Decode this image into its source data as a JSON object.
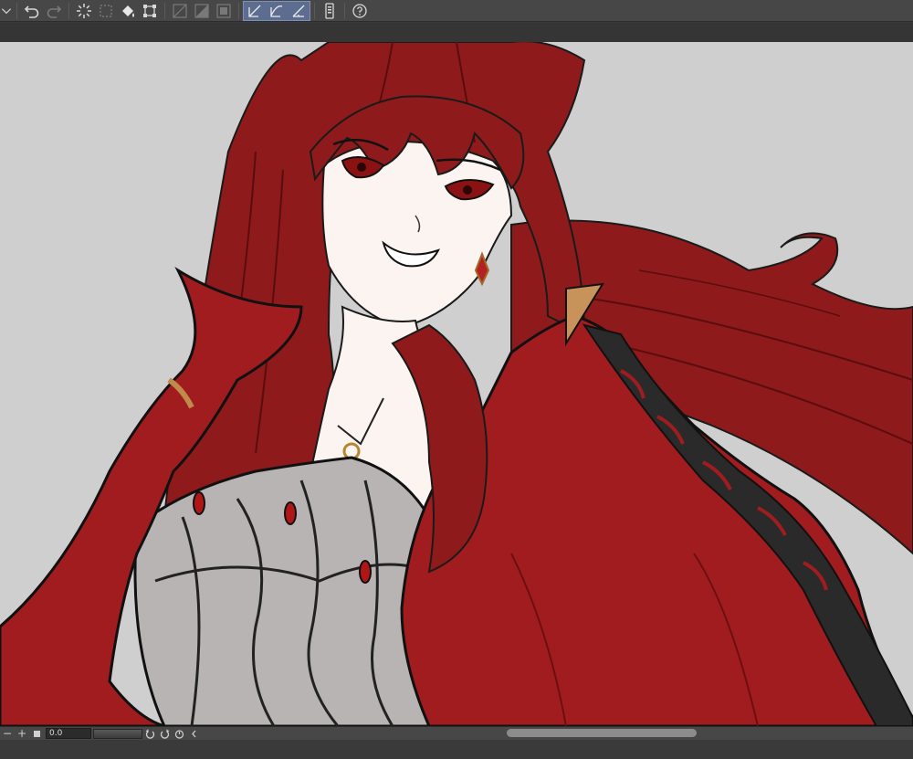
{
  "toolbar": {
    "tools": [
      {
        "name": "menu-chevron-icon"
      },
      {
        "name": "undo-icon"
      },
      {
        "name": "redo-icon"
      },
      {
        "name": "loading-spinner-icon"
      },
      {
        "name": "selection-icon"
      },
      {
        "name": "fill-icon"
      },
      {
        "name": "transform-icon"
      },
      {
        "name": "clear-outside-icon"
      },
      {
        "name": "clear-inside-icon"
      },
      {
        "name": "fill-selection-icon"
      },
      {
        "name": "snap-ruler-icon"
      },
      {
        "name": "snap-special-ruler-icon"
      },
      {
        "name": "snap-grid-icon"
      },
      {
        "name": "device-icon"
      },
      {
        "name": "help-icon"
      }
    ],
    "active_color": "#5d6d8f"
  },
  "statusbar": {
    "zoom_out_label": "−",
    "zoom_in_label": "+",
    "zoom_value": "0.0",
    "scroll_position": 0.55
  },
  "canvas": {
    "background_color": "#cfcfcf",
    "hair_color": "#8b1a1a",
    "coat_color": "#a11c1f",
    "skin_color": "#fbf4f1"
  }
}
